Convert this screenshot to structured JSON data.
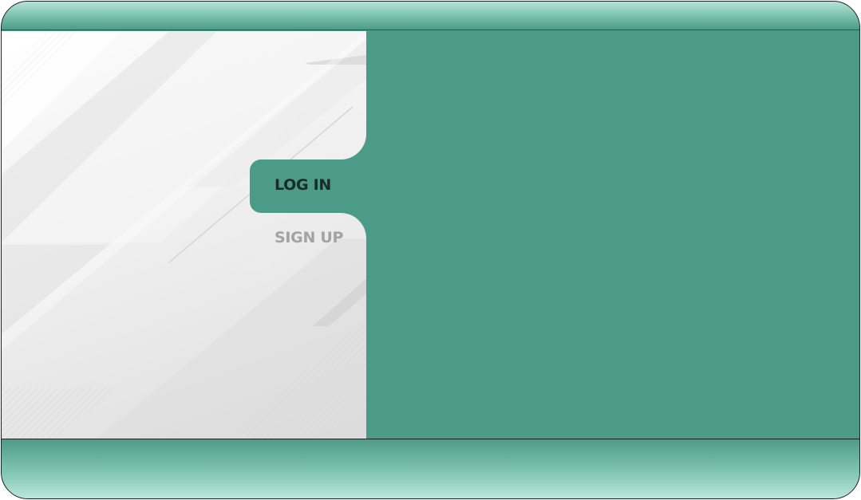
{
  "tabs": {
    "login_label": "LOG IN",
    "signup_label": "SIGN UP",
    "active": "login"
  },
  "colors": {
    "accent": "#4c9a88",
    "bar_light": "#b7e3d6",
    "active_text": "#1c2b27",
    "inactive_text": "#a3a3a3"
  }
}
